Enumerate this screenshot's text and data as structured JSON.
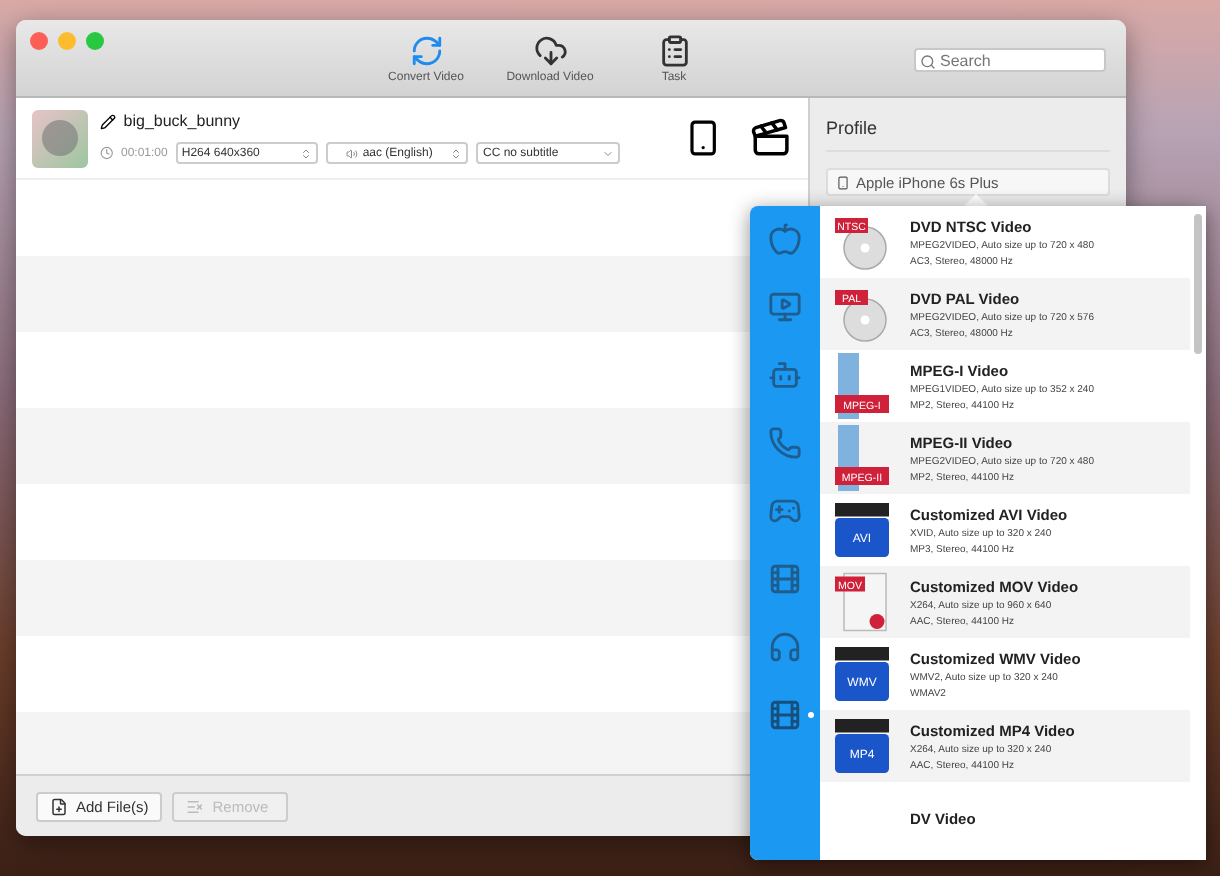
{
  "toolbar": [
    {
      "label": "Convert Video",
      "kind": "convert",
      "selected": true
    },
    {
      "label": "Download Video",
      "kind": "download",
      "selected": false
    },
    {
      "label": "Task",
      "kind": "task",
      "selected": false
    }
  ],
  "search": {
    "placeholder": "Search"
  },
  "files": [
    {
      "name": "big_buck_bunny",
      "duration": "00:01:00",
      "video": "H264 640x360",
      "audio": "aac (English)",
      "subtitle": "CC no subtitle"
    }
  ],
  "profile": {
    "title": "Profile",
    "device": "Apple iPhone 6s Plus"
  },
  "categories": [
    {
      "kind": "apple",
      "selected": false
    },
    {
      "kind": "tv",
      "selected": false
    },
    {
      "kind": "android",
      "selected": false
    },
    {
      "kind": "phone",
      "selected": false
    },
    {
      "kind": "game",
      "selected": false
    },
    {
      "kind": "film",
      "selected": false
    },
    {
      "kind": "headphones",
      "selected": false
    },
    {
      "kind": "video",
      "selected": true
    }
  ],
  "formats": [
    {
      "title": "DVD NTSC Video",
      "kind": "disc",
      "badge": "NTSC",
      "lines": [
        "MPEG2VIDEO, Auto size up to 720 x 480",
        "AC3, Stereo, 48000 Hz"
      ]
    },
    {
      "title": "DVD PAL Video",
      "kind": "disc",
      "badge": "PAL",
      "lines": [
        "MPEG2VIDEO, Auto size up to 720 x 576",
        "AC3, Stereo, 48000 Hz"
      ]
    },
    {
      "title": "MPEG-I Video",
      "kind": "filmstrip",
      "badge": "MPEG-I",
      "lines": [
        "MPEG1VIDEO, Auto size up to 352 x 240",
        "MP2, Stereo, 44100 Hz"
      ]
    },
    {
      "title": "MPEG-II Video",
      "kind": "filmstrip",
      "badge": "MPEG-II",
      "lines": [
        "MPEG2VIDEO, Auto size up to 720 x 480",
        "MP2, Stereo, 44100 Hz"
      ]
    },
    {
      "title": "Customized AVI Video",
      "kind": "clapper",
      "badge": "AVI",
      "lines": [
        "XVID, Auto size up to 320 x 240",
        "MP3, Stereo, 44100 Hz"
      ]
    },
    {
      "title": "Customized MOV Video",
      "kind": "document",
      "badge": "MOV",
      "lines": [
        "X264, Auto size up to 960 x 640",
        "AAC, Stereo, 44100 Hz"
      ]
    },
    {
      "title": "Customized WMV Video",
      "kind": "clapper",
      "badge": "WMV",
      "lines": [
        "WMV2, Auto size up to 320 x 240",
        "WMAV2"
      ]
    },
    {
      "title": "Customized MP4 Video",
      "kind": "clapper",
      "badge": "MP4",
      "lines": [
        "X264, Auto size up to 320 x 240",
        "AAC, Stereo, 44100 Hz"
      ]
    },
    {
      "title": "DV Video",
      "kind": "none"
    }
  ],
  "buttons": [
    {
      "label": "Add File(s)",
      "kind": "add",
      "disabled": false
    },
    {
      "label": "Remove",
      "kind": "remove",
      "disabled": true
    }
  ]
}
